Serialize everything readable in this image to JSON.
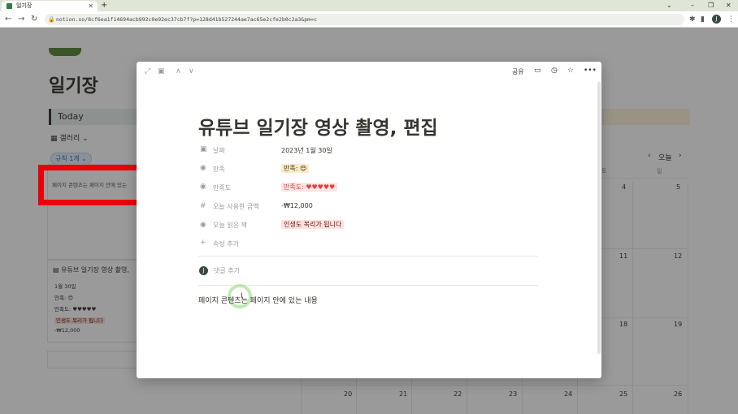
{
  "browser": {
    "tab_title": "일기장",
    "url": "notion.so/8cf6ea1f14694acb992c0e92ec37cb7f?p=128d41b527244ae7ac65e2cfe2b0c2a3&pm=c",
    "profile_initial": "J"
  },
  "background": {
    "page_title": "일기장",
    "today_label": "Today",
    "view_label": "갤러리",
    "filter_chip": "규칙 1개",
    "card1_text": "페이지 콘텐츠는 페이지 안에 있는",
    "card2": {
      "title": "유튜브 일기장 영상 촬영,",
      "date": "1월 30일",
      "satisfaction": "만족: 😍",
      "satisfaction_level": "만족도: ♥♥♥♥♥",
      "book": "인생도 복리가 됩니다",
      "amount": "-₩12,000"
    },
    "calendar": {
      "today_btn": "오늘",
      "weekdays": [
        "토",
        "일"
      ],
      "row1": [
        "4",
        "5"
      ],
      "row2": [
        "11",
        "12"
      ],
      "row3": [
        "18",
        "19"
      ],
      "row4": [
        "20",
        "21",
        "22",
        "23",
        "24",
        "25",
        "26"
      ]
    }
  },
  "modal": {
    "share_label": "공유",
    "title": "유튜브 일기장 영상 촬영, 편집",
    "properties": [
      {
        "label": "날짜",
        "value": "2023년 1월 30일"
      },
      {
        "label": "만족",
        "value": "만족: 😍"
      },
      {
        "label": "만족도",
        "value": "만족도: ♥♥♥♥♥"
      },
      {
        "label": "오늘 사용한 금액",
        "value": "-₩12,000"
      },
      {
        "label": "오늘 읽은 책",
        "value": "인생도 복리가 됩니다"
      }
    ],
    "add_property": "속성 추가",
    "comment_initial": "J",
    "comment_placeholder": "댓글 추가",
    "body_text": "페이지 콘텐츠는 페이지 안에 있는 내용"
  },
  "colors": {
    "highlight_red": "#e8000b",
    "heart_red": "#e03e3e"
  }
}
